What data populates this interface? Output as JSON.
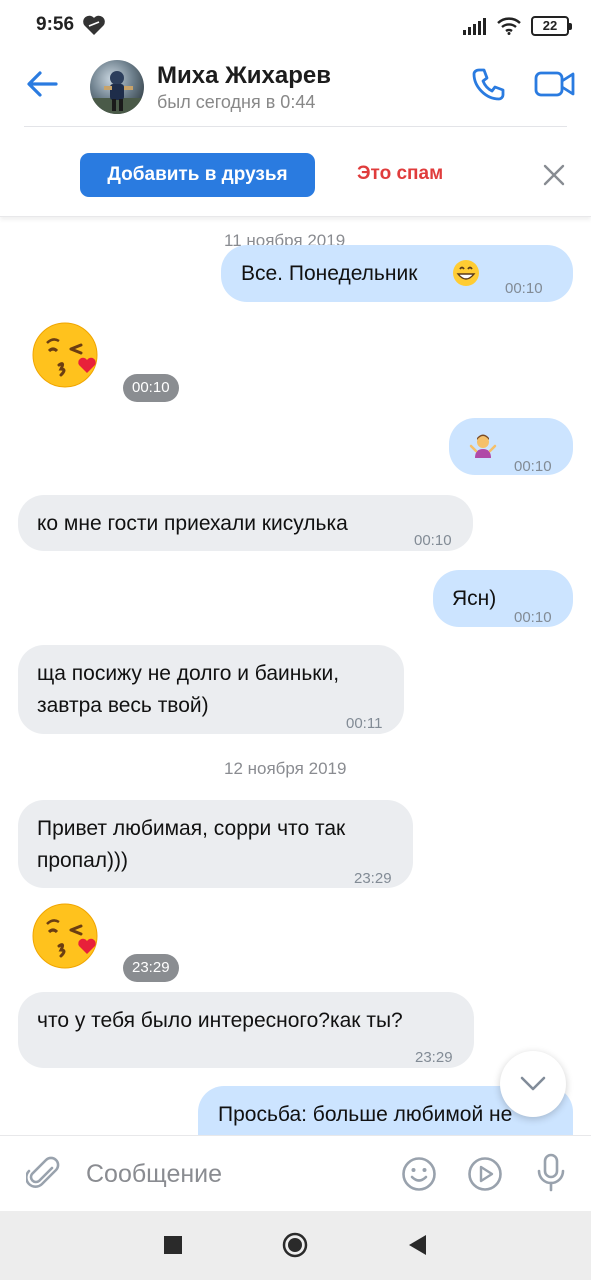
{
  "status_bar": {
    "time": "9:56",
    "battery": "22",
    "icons": [
      "heart-shield-icon",
      "signal-icon",
      "wifi-icon",
      "battery-icon"
    ]
  },
  "header": {
    "contact_name": "Миха Жихарев",
    "last_seen": "был сегодня в 0:44",
    "icons": [
      "back-arrow-icon",
      "phone-icon",
      "video-camera-icon"
    ],
    "accent_color": "#2a7be0"
  },
  "request_bar": {
    "add_friend_label": "Добавить в друзья",
    "spam_label": "Это спам",
    "spam_color": "#e03c3c"
  },
  "messages": [
    {
      "type": "date",
      "text": "11 ноября 2019"
    },
    {
      "type": "out",
      "text": "Все. Понедельник",
      "emoji": "grinning-face",
      "time": "00:10"
    },
    {
      "type": "in_emoji",
      "emoji": "face-blowing-kiss",
      "time": "00:10"
    },
    {
      "type": "out",
      "text": "",
      "emoji": "person-shrugging",
      "time": "00:10"
    },
    {
      "type": "in",
      "text": "ко мне гости приехали кисулька",
      "time": "00:10"
    },
    {
      "type": "out",
      "text": "Ясн)",
      "time": "00:10"
    },
    {
      "type": "in",
      "lines": [
        "ща посижу не долго и баиньки,",
        "завтра весь твой)"
      ],
      "time": "00:11"
    },
    {
      "type": "date",
      "text": "12 ноября 2019"
    },
    {
      "type": "in",
      "lines": [
        "Привет любимая, сорри что так",
        "пропал)))"
      ],
      "time": "23:29"
    },
    {
      "type": "in_emoji",
      "emoji": "face-blowing-kiss",
      "time": "23:29"
    },
    {
      "type": "in",
      "text": "что у тебя было интересного?как ты?",
      "time": "23:29"
    },
    {
      "type": "out",
      "text": "Просьба: больше любимой не",
      "time": ""
    }
  ],
  "composer": {
    "placeholder": "Сообщение",
    "icons": [
      "paperclip-icon",
      "sticker-smile-icon",
      "voice-message-play-icon",
      "microphone-icon"
    ]
  },
  "nav": {
    "icons": [
      "recents-square-icon",
      "home-circle-icon",
      "back-triangle-icon"
    ]
  },
  "colors": {
    "incoming_bubble": "#ebedf0",
    "outgoing_bubble": "#cce4ff"
  }
}
